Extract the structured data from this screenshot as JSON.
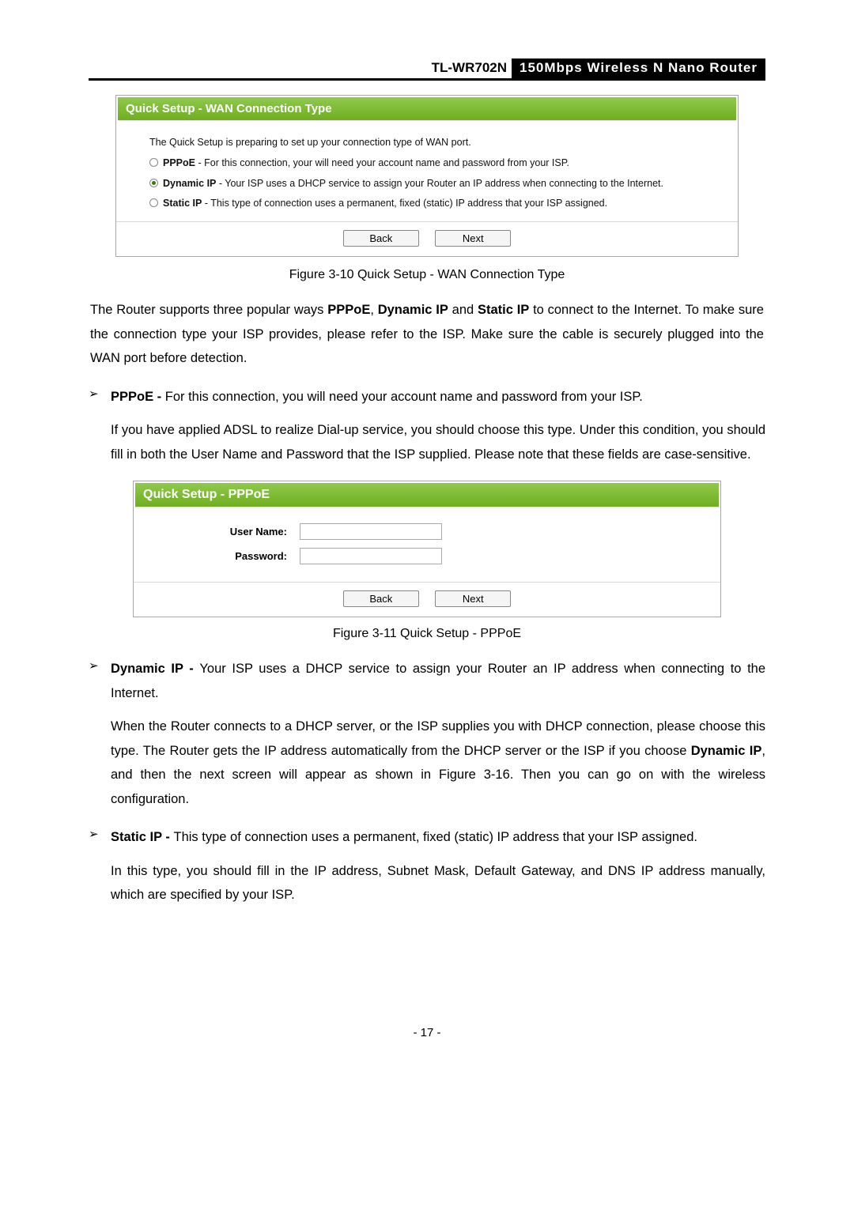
{
  "header": {
    "model": "TL-WR702N",
    "title": "150Mbps  Wireless  N  Nano  Router"
  },
  "shot1": {
    "title": "Quick Setup - WAN Connection Type",
    "intro": "The Quick Setup is preparing to set up your connection type of WAN port.",
    "opt_pppoe_bold": "PPPoE",
    "opt_pppoe_rest": " - For this connection, your will need your account name and password from your ISP.",
    "opt_dyn_bold": "Dynamic IP",
    "opt_dyn_rest": " - Your ISP uses a DHCP service to assign your Router an IP address when connecting to the Internet.",
    "opt_static_bold": "Static IP",
    "opt_static_rest": " - This type of connection uses a permanent, fixed (static) IP address that your ISP assigned.",
    "back": "Back",
    "next": "Next",
    "caption": "Figure 3-10 Quick Setup - WAN Connection Type"
  },
  "body": {
    "p1a": "The Router supports three popular ways ",
    "p1b": "PPPoE",
    "p1c": ", ",
    "p1d": "Dynamic IP",
    "p1e": " and ",
    "p1f": "Static IP",
    "p1g": " to connect to the Internet. To make sure the connection type your ISP provides, please refer to the ISP. Make sure the cable is securely plugged into the WAN port before detection.",
    "pppoe_head": "PPPoE - ",
    "pppoe_txt": "For this connection, you will need your account name and password from your ISP.",
    "pppoe_sub": "If you have applied ADSL to realize Dial-up service, you should choose this type. Under this condition, you should fill in both the User Name and Password that the ISP supplied. Please note that these fields are case-sensitive.",
    "dyn_head": "Dynamic IP - ",
    "dyn_txt": "Your ISP uses a DHCP service to assign your Router an IP address when connecting to the Internet.",
    "dyn_sub_a": "When the Router connects to a DHCP server, or the ISP supplies you with DHCP connection, please choose this type. The Router gets the IP address automatically from the DHCP server or the ISP if you choose ",
    "dyn_sub_b": "Dynamic IP",
    "dyn_sub_c": ", and then the next screen will appear as shown in Figure 3-16. Then you can go on with the wireless configuration.",
    "static_head": "Static IP - ",
    "static_txt": "This type of connection uses a permanent, fixed (static) IP address that your ISP assigned.",
    "static_sub": "In this type, you should fill in the IP address, Subnet Mask, Default Gateway, and DNS IP address manually, which are specified by your ISP."
  },
  "shot2": {
    "title": "Quick Setup - PPPoE",
    "username_label": "User Name:",
    "password_label": "Password:",
    "back": "Back",
    "next": "Next",
    "caption": "Figure 3-11   Quick Setup - PPPoE"
  },
  "page_number": "- 17 -"
}
